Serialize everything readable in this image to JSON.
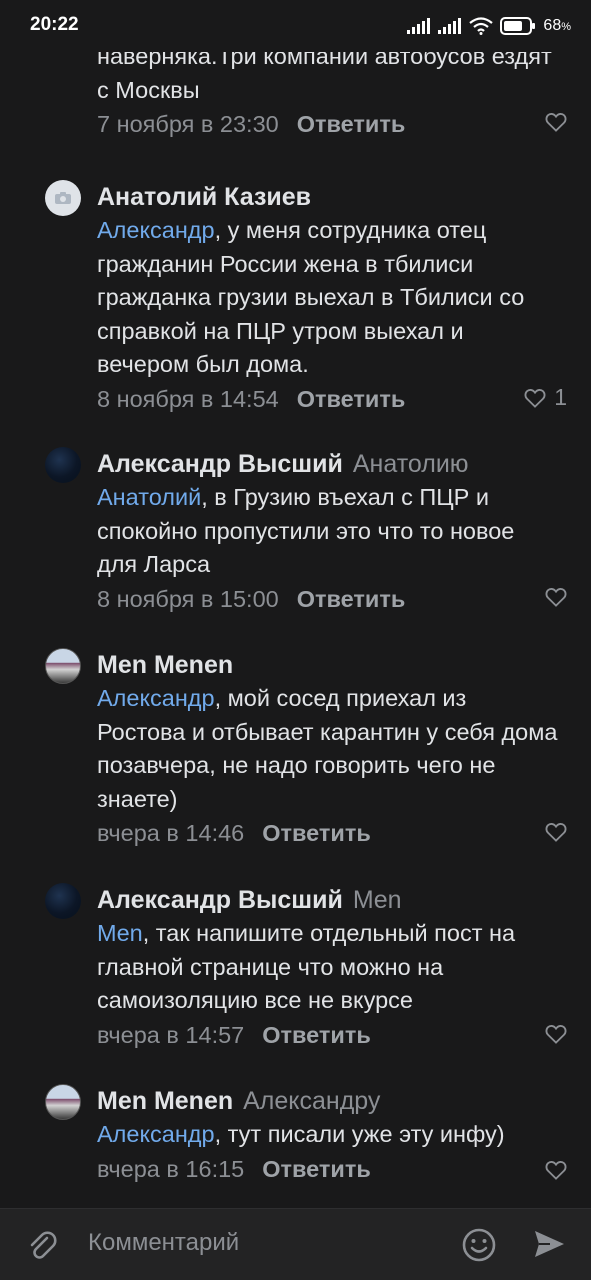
{
  "status_bar": {
    "time": "20:22",
    "battery": "68"
  },
  "comments": [
    {
      "author": "",
      "reply_to": "",
      "mention": "",
      "text": "наверняка.Три компании автобусов ездят с Москвы",
      "date": "7 ноября в 23:30",
      "reply_label": "Ответить",
      "likes": ""
    },
    {
      "author": "Анатолий Казиев",
      "reply_to": "",
      "mention": "Александр",
      "text": ", у меня сотрудника отец гражданин России жена в тбилиси гражданка грузии выехал в Тбилиси со справкой на ПЦР утром выехал и вечером был дома.",
      "date": "8 ноября в 14:54",
      "reply_label": "Ответить",
      "likes": "1"
    },
    {
      "author": "Александр Высший",
      "reply_to": "Анатолию",
      "mention": "Анатолий",
      "text": ", в Грузию въехал с ПЦР и спокойно пропустили это что то новое для Ларса",
      "date": "8 ноября в 15:00",
      "reply_label": "Ответить",
      "likes": ""
    },
    {
      "author": "Men Menen",
      "reply_to": "",
      "mention": "Александр",
      "text": ", мой сосед приехал из Ростова и отбывает карантин у себя дома позавчера, не надо говорить чего не знаете)",
      "date": "вчера в 14:46",
      "reply_label": "Ответить",
      "likes": ""
    },
    {
      "author": "Александр Высший",
      "reply_to": "Men",
      "mention": "Men",
      "text": ", так напишите отдельный пост на главной странице что можно на самоизоляцию все не вкурсе",
      "date": "вчера в 14:57",
      "reply_label": "Ответить",
      "likes": ""
    },
    {
      "author": "Men Menen",
      "reply_to": "Александру",
      "mention": "Александр",
      "text": ", тут писали уже эту инфу)",
      "date": "вчера в 16:15",
      "reply_label": "Ответить",
      "likes": ""
    }
  ],
  "composer": {
    "placeholder": "Комментарий"
  }
}
